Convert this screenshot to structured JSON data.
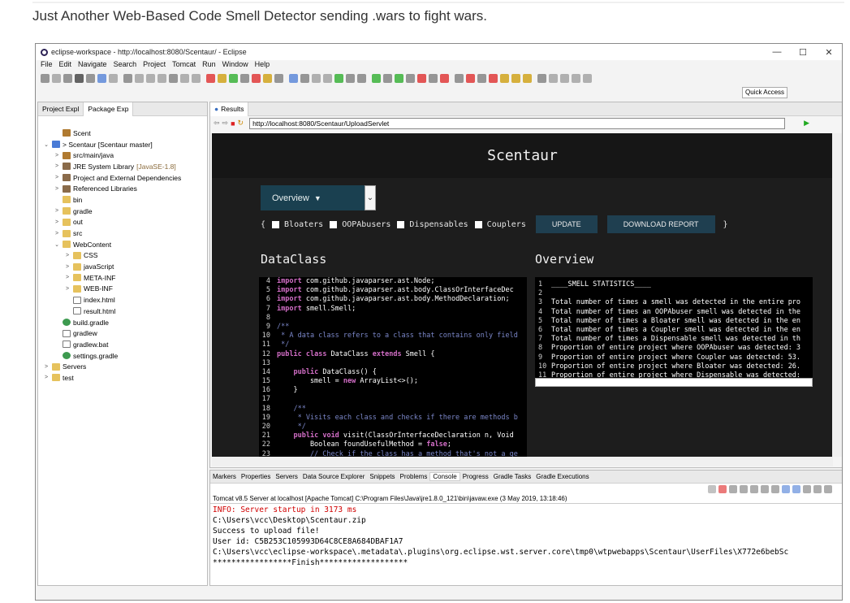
{
  "caption": "Just Another Web-Based Code Smell Detector sending .wars to fight wars.",
  "window": {
    "title": "eclipse-workspace - http://localhost:8080/Scentaur/ - Eclipse",
    "minimize": "—",
    "maximize": "☐",
    "close": "✕"
  },
  "menu": [
    "File",
    "Edit",
    "Navigate",
    "Search",
    "Project",
    "Tomcat",
    "Run",
    "Window",
    "Help"
  ],
  "quick_access": "Quick Access",
  "left_panel": {
    "tabs": [
      "Project Expl",
      "Package Exp"
    ],
    "tree": [
      {
        "label": "Scent",
        "indent": 1,
        "chevron": "",
        "icon": "pkg"
      },
      {
        "label": "> Scentaur [Scentaur master]",
        "indent": 0,
        "chevron": "⌄",
        "icon": "proj"
      },
      {
        "label": "src/main/java",
        "indent": 1,
        "chevron": ">",
        "icon": "pkg"
      },
      {
        "label": "JRE System Library",
        "deco": "[JavaSE-1.8]",
        "indent": 1,
        "chevron": ">",
        "icon": "lib"
      },
      {
        "label": "Project and External Dependencies",
        "indent": 1,
        "chevron": ">",
        "icon": "lib"
      },
      {
        "label": "Referenced Libraries",
        "indent": 1,
        "chevron": ">",
        "icon": "lib"
      },
      {
        "label": "bin",
        "indent": 1,
        "chevron": "",
        "icon": "folder"
      },
      {
        "label": "gradle",
        "indent": 1,
        "chevron": ">",
        "icon": "folder"
      },
      {
        "label": "out",
        "indent": 1,
        "chevron": ">",
        "icon": "folder"
      },
      {
        "label": "src",
        "indent": 1,
        "chevron": ">",
        "icon": "folder"
      },
      {
        "label": "WebContent",
        "indent": 1,
        "chevron": "⌄",
        "icon": "folder"
      },
      {
        "label": "CSS",
        "indent": 2,
        "chevron": ">",
        "icon": "folder"
      },
      {
        "label": "javaScript",
        "indent": 2,
        "chevron": ">",
        "icon": "folder"
      },
      {
        "label": "META-INF",
        "indent": 2,
        "chevron": ">",
        "icon": "folder"
      },
      {
        "label": "WEB-INF",
        "indent": 2,
        "chevron": ">",
        "icon": "folder"
      },
      {
        "label": "index.html",
        "indent": 2,
        "chevron": "",
        "icon": "file"
      },
      {
        "label": "result.html",
        "indent": 2,
        "chevron": "",
        "icon": "file"
      },
      {
        "label": "build.gradle",
        "indent": 1,
        "chevron": "",
        "icon": "gradle"
      },
      {
        "label": "gradlew",
        "indent": 1,
        "chevron": "",
        "icon": "file"
      },
      {
        "label": "gradlew.bat",
        "indent": 1,
        "chevron": "",
        "icon": "file"
      },
      {
        "label": "settings.gradle",
        "indent": 1,
        "chevron": "",
        "icon": "gradle"
      },
      {
        "label": "Servers",
        "indent": 0,
        "chevron": ">",
        "icon": "folder"
      },
      {
        "label": "test",
        "indent": 0,
        "chevron": ">",
        "icon": "folder"
      }
    ]
  },
  "browser": {
    "tab": "Results",
    "url": "http://localhost:8080/Scentaur/UploadServlet",
    "page": {
      "title": "Scentaur",
      "dropdown": "Overview",
      "brace_open": "{",
      "brace_close": "}",
      "filters": [
        "Bloaters",
        "OOPAbusers",
        "Dispensables",
        "Couplers"
      ],
      "update_button": "UPDATE",
      "download_button": "DOWNLOAD REPORT",
      "left_heading": "DataClass",
      "right_heading": "Overview",
      "code": [
        {
          "n": "4",
          "t": "import com.github.javaparser.ast.Node;"
        },
        {
          "n": "5",
          "t": "import com.github.javaparser.ast.body.ClassOrInterfaceDec"
        },
        {
          "n": "6",
          "t": "import com.github.javaparser.ast.body.MethodDeclaration;"
        },
        {
          "n": "7",
          "t": "import smell.Smell;"
        },
        {
          "n": "8",
          "t": ""
        },
        {
          "n": "9",
          "t": "/**"
        },
        {
          "n": "10",
          "t": " * A data class refers to a class that contains only field"
        },
        {
          "n": "11",
          "t": " */"
        },
        {
          "n": "12",
          "t": "public class DataClass extends Smell {"
        },
        {
          "n": "13",
          "t": ""
        },
        {
          "n": "14",
          "t": "    public DataClass() {"
        },
        {
          "n": "15",
          "t": "        smell = new ArrayList<>();"
        },
        {
          "n": "16",
          "t": "    }"
        },
        {
          "n": "17",
          "t": ""
        },
        {
          "n": "18",
          "t": "    /**"
        },
        {
          "n": "19",
          "t": "     * Visits each class and checks if there are methods b"
        },
        {
          "n": "20",
          "t": "     */"
        },
        {
          "n": "21",
          "t": "    public void visit(ClassOrInterfaceDeclaration n, Void"
        },
        {
          "n": "22",
          "t": "        Boolean foundUsefulMethod = false;"
        },
        {
          "n": "23",
          "t": "        // Check if the class has a method that's not a ge"
        }
      ],
      "overview": [
        {
          "n": "1",
          "t": "____SMELL STATISTICS____"
        },
        {
          "n": "2",
          "t": ""
        },
        {
          "n": "3",
          "t": "Total number of times a smell was detected in the entire pro"
        },
        {
          "n": "4",
          "t": "Total number of times an OOPAbuser smell was detected in the"
        },
        {
          "n": "5",
          "t": "Total number of times a Bloater smell was detected in the en"
        },
        {
          "n": "6",
          "t": "Total number of times a Coupler smell was detected in the en"
        },
        {
          "n": "7",
          "t": "Total number of times a Dispensable smell was detected in th"
        },
        {
          "n": "8",
          "t": "Proportion of entire project where OOPAbuser was detected: 3"
        },
        {
          "n": "9",
          "t": "Proportion of entire project where Coupler was detected: 53."
        },
        {
          "n": "10",
          "t": "Proportion of entire project where Bloater was detected: 26."
        },
        {
          "n": "11",
          "t": "Proportion of entire project where Dispensable was detected:"
        }
      ]
    }
  },
  "console": {
    "tabs": [
      "Markers",
      "Properties",
      "Servers",
      "Data Source Explorer",
      "Snippets",
      "Problems",
      "Console",
      "Progress",
      "Gradle Tasks",
      "Gradle Executions"
    ],
    "active_tab": "Console",
    "server_line": "Tomcat v8.5 Server at localhost [Apache Tomcat] C:\\Program Files\\Java\\jre1.8.0_121\\bin\\javaw.exe (3 May 2019, 13:18:46)",
    "lines": [
      {
        "t": "INFO: Server startup in 3173 ms",
        "c": "#d00000"
      },
      {
        "t": "C:\\Users\\vcc\\Desktop\\Scentaur.zip",
        "c": "#000000"
      },
      {
        "t": "Success to upload file!",
        "c": "#000000"
      },
      {
        "t": "User id: C5B253C105993D64C8CE8A684DBAF1A7",
        "c": "#000000"
      },
      {
        "t": "C:\\Users\\vcc\\eclipse-workspace\\.metadata\\.plugins\\org.eclipse.wst.server.core\\tmp0\\wtpwebapps\\Scentaur\\UserFiles\\X772e6bebSc",
        "c": "#000000"
      },
      {
        "t": "*****************Finish*******************",
        "c": "#000000"
      }
    ]
  },
  "colors": {
    "keyword": "#d36ec7",
    "comment": "#7a86c8",
    "page_bg": "#101010",
    "accent": "#1f3f50"
  }
}
